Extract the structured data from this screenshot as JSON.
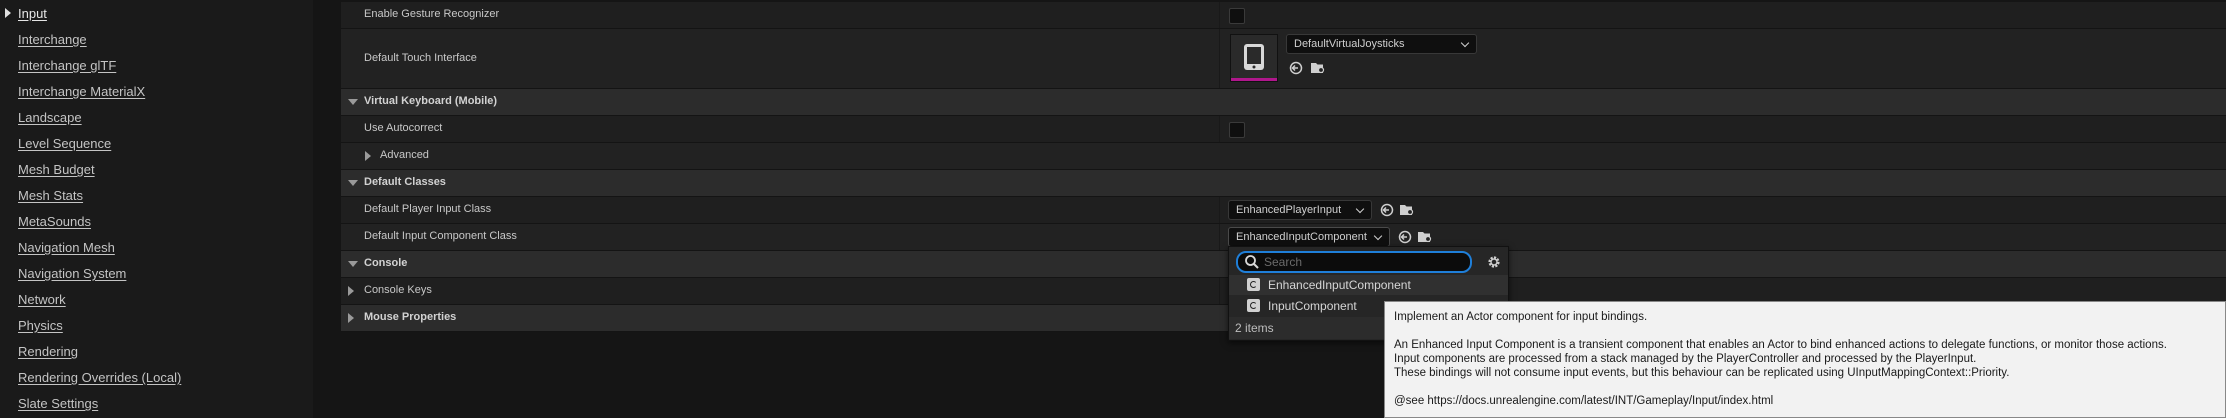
{
  "nav": {
    "items": [
      {
        "label": "Input"
      },
      {
        "label": "Interchange"
      },
      {
        "label": "Interchange glTF"
      },
      {
        "label": "Interchange MaterialX"
      },
      {
        "label": "Landscape"
      },
      {
        "label": "Level Sequence"
      },
      {
        "label": "Mesh Budget"
      },
      {
        "label": "Mesh Stats"
      },
      {
        "label": "MetaSounds"
      },
      {
        "label": "Navigation Mesh"
      },
      {
        "label": "Navigation System"
      },
      {
        "label": "Network"
      },
      {
        "label": "Physics"
      },
      {
        "label": "Rendering"
      },
      {
        "label": "Rendering Overrides (Local)"
      },
      {
        "label": "Slate Settings"
      }
    ]
  },
  "properties": {
    "enable_gesture_recognizer": {
      "label": "Enable Gesture Recognizer",
      "checked": false
    },
    "default_touch_interface": {
      "label": "Default Touch Interface",
      "value": "DefaultVirtualJoysticks"
    },
    "virtual_keyboard": {
      "label": "Virtual Keyboard (Mobile)"
    },
    "use_autocorrect": {
      "label": "Use Autocorrect",
      "checked": false
    },
    "advanced": {
      "label": "Advanced"
    },
    "default_classes": {
      "label": "Default Classes"
    },
    "default_player_input_class": {
      "label": "Default Player Input Class",
      "value": "EnhancedPlayerInput"
    },
    "default_input_component_class": {
      "label": "Default Input Component Class",
      "value": "EnhancedInputComponent"
    },
    "console": {
      "label": "Console"
    },
    "console_keys": {
      "label": "Console Keys"
    },
    "mouse_properties": {
      "label": "Mouse Properties"
    }
  },
  "dropdown": {
    "search_placeholder": "Search",
    "items": [
      {
        "label": "EnhancedInputComponent"
      },
      {
        "label": "InputComponent"
      }
    ],
    "count": "2 items"
  },
  "tooltip": {
    "line1": "Implement an Actor component for input bindings.",
    "line2": "An Enhanced Input Component is a transient component that enables an Actor to bind enhanced actions to delegate functions, or monitor those actions.",
    "line3": "Input components are processed from a stack managed by the PlayerController and processed by the PlayerInput.",
    "line4": "These bindings will not consume input events, but this behaviour can be replicated using UInputMappingContext::Priority.",
    "line5": "@see https://docs.unrealengine.com/latest/INT/Gameplay/Input/index.html"
  },
  "colors": {
    "accent": "#1f7fd9",
    "thumbnail_underline": "#b0178c",
    "panel_bg": "#151515"
  },
  "icons": {
    "selected_nav_caret": "caret-right-icon",
    "thumbnail": "tablet-icon",
    "use_selected": "arrow-left-circle-icon",
    "browse": "folder-search-icon",
    "search": "magnifier-icon",
    "settings": "gear-icon",
    "class": "class-c-icon"
  }
}
